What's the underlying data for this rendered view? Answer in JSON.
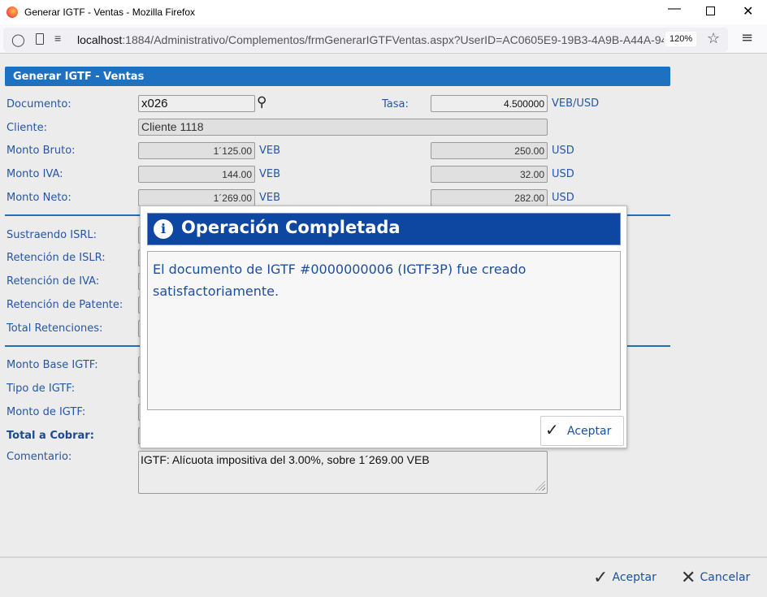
{
  "window": {
    "title": "Generar IGTF - Ventas - Mozilla Firefox"
  },
  "browser": {
    "url_host": "localhost",
    "url_rest": ":1884/Administrativo/Complementos/frmGenerarIGTFVentas.aspx?UserID=AC0605E9-19B3-4A9B-A44A-94!",
    "zoom": "120%"
  },
  "form": {
    "title": "Generar IGTF - Ventas",
    "documento_label": "Documento:",
    "documento_value": "x026",
    "tasa_label": "Tasa:",
    "tasa_value": "4.500000",
    "tasa_unit": "VEB/USD",
    "cliente_label": "Cliente:",
    "cliente_value": "Cliente 1118",
    "rows": [
      {
        "label": "Monto Bruto:",
        "veb": "1´125.00",
        "usd": "250.00"
      },
      {
        "label": "Monto IVA:",
        "veb": "144.00",
        "usd": "32.00"
      },
      {
        "label": "Monto Neto:",
        "veb": "1´269.00",
        "usd": "282.00"
      }
    ],
    "unit_veb": "VEB",
    "unit_usd": "USD",
    "retenciones": [
      "Sustraendo ISRL:",
      "Retención de ISLR:",
      "Retención de IVA:",
      "Retención de Patente:",
      "Total Retenciones:"
    ],
    "igtf": [
      "Monto Base IGTF:",
      "Tipo de IGTF:",
      "Monto de IGTF:"
    ],
    "total_label": "Total a Cobrar:",
    "comentario_label": "Comentario:",
    "comentario_value": "IGTF: Alícuota impositiva del 3.00%, sobre 1´269.00 VEB"
  },
  "dialog": {
    "title": "Operación Completada",
    "message": "El documento de IGTF #0000000006 (IGTF3P) fue creado satisfactoriamente.",
    "accept": "Aceptar"
  },
  "footer": {
    "accept": "Aceptar",
    "cancel": "Cancelar"
  }
}
